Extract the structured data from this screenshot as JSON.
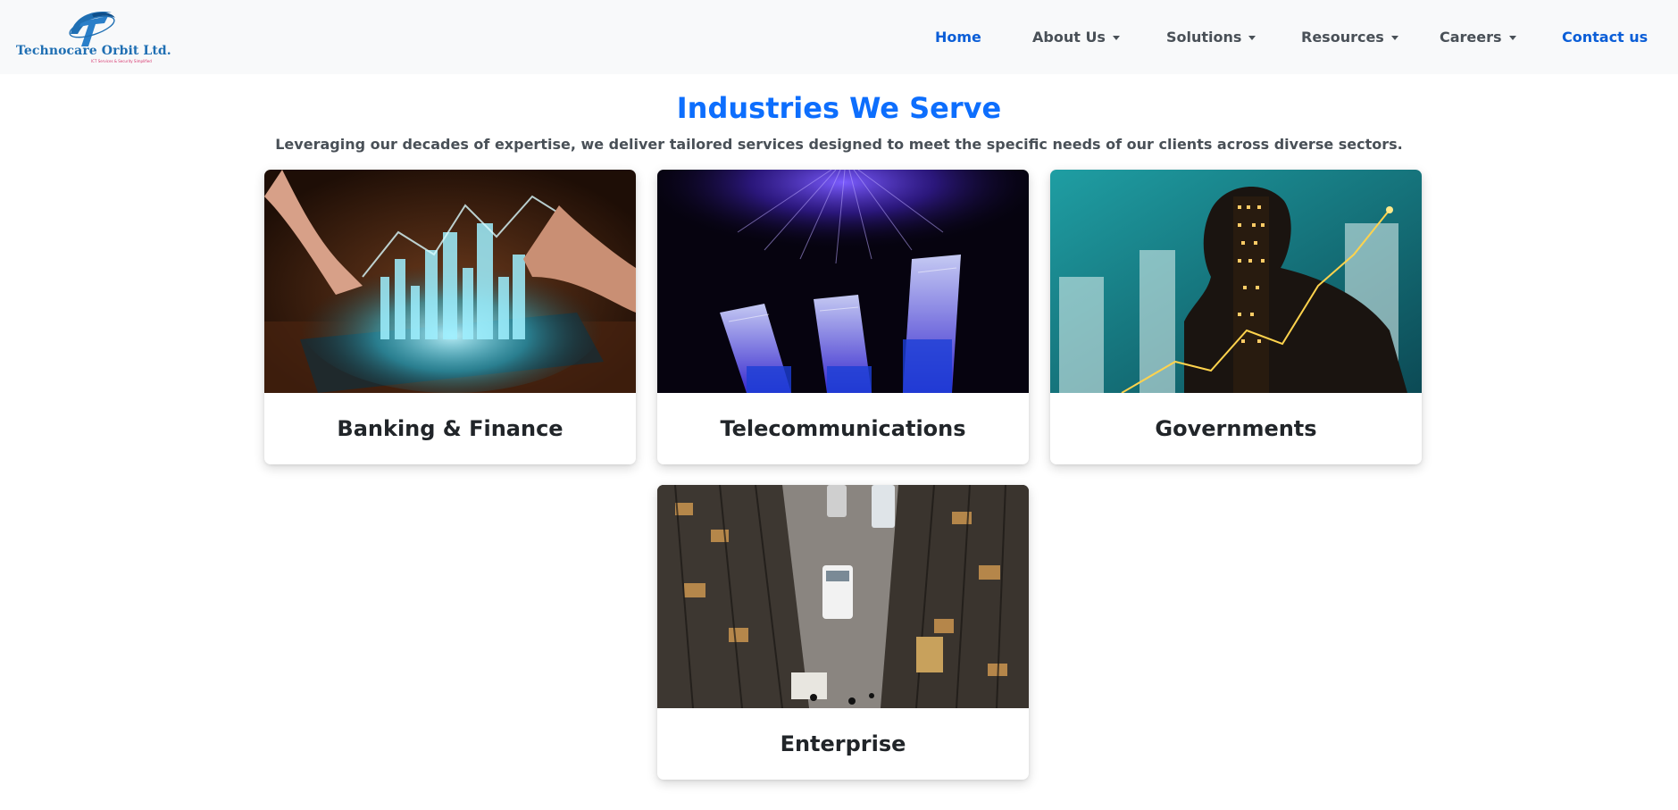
{
  "brand": {
    "name": "Technocare Orbit Ltd.",
    "tagline": "ICT Services & Security Simplified",
    "logo_icon": "orbit-logo-icon",
    "colors": {
      "primary": "#1f6fb3",
      "accent": "#d6336c"
    }
  },
  "nav": {
    "home": "Home",
    "about": "About Us",
    "solutions": "Solutions",
    "resources": "Resources",
    "careers": "Careers",
    "contact": "Contact us",
    "dropdown_icon": "caret-down-icon"
  },
  "section": {
    "title": "Industries We Serve",
    "subtitle": "Leveraging our decades of expertise, we deliver tailored services designed to meet the specific needs of our clients across diverse sectors."
  },
  "industries": [
    {
      "title": "Banking & Finance",
      "image": "holographic-city-chart-image"
    },
    {
      "title": "Telecommunications",
      "image": "fiber-optic-network-cables-image"
    },
    {
      "title": "Governments",
      "image": "city-skyline-silhouette-image"
    },
    {
      "title": "Enterprise",
      "image": "aerial-city-street-trucks-image"
    }
  ],
  "theme": {
    "accent": "#0d6efd",
    "nav_active": "#0b5ed7",
    "nav_bg": "#f8f9fa",
    "text": "#212529"
  }
}
